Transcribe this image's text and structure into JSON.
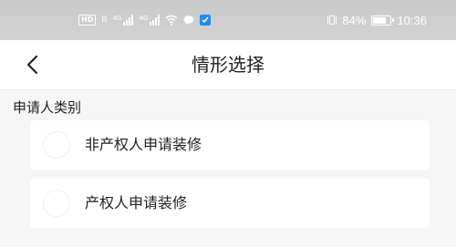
{
  "status_bar": {
    "hd_label": "HD",
    "hd_sub": "B",
    "signal_1_label": "4G",
    "signal_2_label": "4G",
    "battery_percent": "84%",
    "time": "10:36",
    "battery_level": 0.84,
    "app_badge_color": "#1f8cf0"
  },
  "nav": {
    "back_icon": "chevron-left-icon",
    "title": "情形选择"
  },
  "section": {
    "label": "申请人类别"
  },
  "options": [
    {
      "label": "非产权人申请装修",
      "selected": false
    },
    {
      "label": "产权人申请装修",
      "selected": false
    }
  ]
}
